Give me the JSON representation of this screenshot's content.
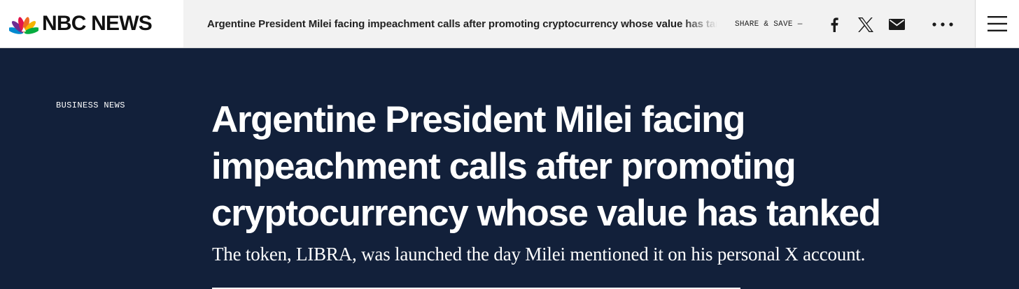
{
  "header": {
    "brand": "NBC NEWS",
    "strip_headline": "Argentine President Milei facing impeachment calls after promoting cryptocurrency whose value has tanked",
    "share_label": "SHARE & SAVE —",
    "share_icons": [
      "facebook-icon",
      "x-icon",
      "email-icon",
      "more-icon"
    ],
    "menu_icon": "hamburger-menu-icon"
  },
  "article": {
    "section": "BUSINESS NEWS",
    "headline": "Argentine President Milei facing impeachment calls after promoting cryptocurrency whose value has tanked",
    "dek": "The token, LIBRA, was launched the day Milei mentioned it on his personal X account."
  },
  "colors": {
    "hero_background": "#12203a",
    "header_background": "#ffffff",
    "share_strip_background": "#f2f2f2",
    "peacock": [
      "#f7b400",
      "#ef6a22",
      "#e2134a",
      "#6f2c91",
      "#0089cf",
      "#05ac3f"
    ]
  }
}
